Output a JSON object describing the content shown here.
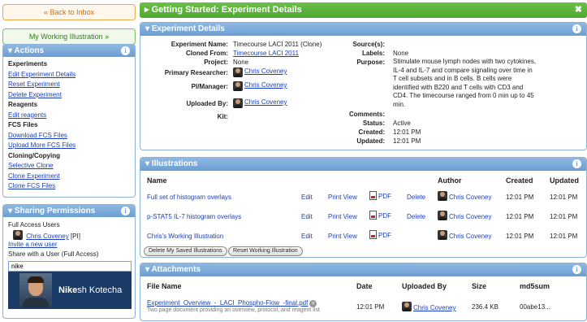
{
  "left": {
    "back_label": "« Back to Inbox",
    "illustration_label": "My Working Illustration »",
    "actions": {
      "title": "Actions",
      "items": [
        {
          "label": "Experiments",
          "kind": "header"
        },
        {
          "label": "Edit Experiment Details",
          "kind": "link"
        },
        {
          "label": "Reset Experiment",
          "kind": "link"
        },
        {
          "label": "Delete Experiment",
          "kind": "link"
        },
        {
          "label": "Reagents",
          "kind": "header"
        },
        {
          "label": "Edit reagents",
          "kind": "link"
        },
        {
          "label": "FCS Files",
          "kind": "header"
        },
        {
          "label": "Download FCS Files",
          "kind": "link"
        },
        {
          "label": "Upload More FCS Files",
          "kind": "link"
        },
        {
          "label": "Cloning/Copying",
          "kind": "header"
        },
        {
          "label": "Selective Clone",
          "kind": "link"
        },
        {
          "label": "Clone Experiment",
          "kind": "link"
        },
        {
          "label": "Clone FCS Files",
          "kind": "link"
        }
      ]
    },
    "sharing": {
      "title": "Sharing Permissions",
      "full_access_label": "Full Access Users",
      "user_name": "Chris Coveney",
      "user_role": "[PI]",
      "invite_label": "Invite a new user",
      "share_label": "Share with a User (Full Access)",
      "input_value": "nike",
      "suggestion_bold": "Nike",
      "suggestion_rest": "sh Kotecha"
    }
  },
  "header": {
    "title": "Getting Started: Experiment Details",
    "close_glyph": "✖"
  },
  "details": {
    "title": "Experiment Details",
    "left_fields": [
      {
        "key": "Experiment Name:",
        "value": "Timecourse LACI 2011 (Clone)",
        "kind": "text"
      },
      {
        "key": "Cloned From:",
        "value": "Timecourse LACI 2011",
        "kind": "link"
      },
      {
        "key": "Project:",
        "value": "None",
        "kind": "text"
      },
      {
        "key": "Primary Researcher:",
        "value": "Chris Coveney",
        "kind": "user"
      },
      {
        "key": "PI/Manager:",
        "value": "Chris Coveney",
        "kind": "user"
      },
      {
        "key": "Uploaded By:",
        "value": "Chris Coveney",
        "kind": "user"
      },
      {
        "key": "Kit:",
        "value": "",
        "kind": "text"
      }
    ],
    "right_fields": {
      "sources_key": "Source(s):",
      "sources_value": "",
      "labels_key": "Labels:",
      "labels_value": "None",
      "purpose_key": "Purpose:",
      "purpose_lines": [
        "Stimulate mouse lymph nodes with two cytokines,",
        "IL-4 and IL-7 and compare signaling over time in",
        "T cell subsets and in B cells. B cells were",
        "identified with B220 and T cells with CD3 and",
        "CD4. The timecourse ranged from 0 min up to 45",
        "min."
      ],
      "comments_key": "Comments:",
      "comments_value": "",
      "status_key": "Status:",
      "status_value": "Active",
      "created_key": "Created:",
      "created_value": "12:01 PM",
      "updated_key": "Updated:",
      "updated_value": "12:01 PM"
    }
  },
  "illustrations": {
    "title": "Illustrations",
    "columns": {
      "name": "Name",
      "author": "Author",
      "created": "Created",
      "updated": "Updated"
    },
    "rows": [
      {
        "name": "Full set of histogram overlays",
        "edit": "Edit",
        "print": "Print View",
        "pdf": "PDF",
        "delete": "Delete",
        "author": "Chris Coveney",
        "created": "12:01 PM",
        "updated": "12:01 PM"
      },
      {
        "name": "p-STAT5 IL-7 histogram overlays",
        "edit": "Edit",
        "print": "Print View",
        "pdf": "PDF",
        "delete": "Delete",
        "author": "Chris Coveney",
        "created": "12:01 PM",
        "updated": "12:01 PM"
      },
      {
        "name": "Chris's Working Illustration",
        "edit": "Edit",
        "print": "Print View",
        "pdf": "PDF",
        "delete": "",
        "author": "Chris Coveney",
        "created": "12:01 PM",
        "updated": "12:01 PM"
      }
    ],
    "delete_saved_label": "Delete My Saved Illustrations",
    "reset_working_label": "Reset Working Illustration"
  },
  "attachments": {
    "title": "Attachments",
    "columns": {
      "file": "File Name",
      "date": "Date",
      "uploaded_by": "Uploaded By",
      "size": "Size",
      "md5": "md5sum"
    },
    "rows": [
      {
        "file": "Experiment_Overview_-_LACI_Phospho-Flow_-final.pdf",
        "description": "Two page document providing an overview, protocol, and reagent list",
        "date": "12:01 PM",
        "uploaded_by": "Chris Coveney",
        "size": "236.4 KB",
        "md5": "00abe13..."
      }
    ]
  },
  "colors": {
    "green_header": "#4ea82f",
    "blue_header": "#6b9ed3",
    "link": "#1a3fb8",
    "orange_button": "#d0700b"
  },
  "icons": [
    "chevron-down-icon",
    "info-icon",
    "close-icon",
    "avatar-icon",
    "pdf-icon",
    "remove-icon"
  ]
}
